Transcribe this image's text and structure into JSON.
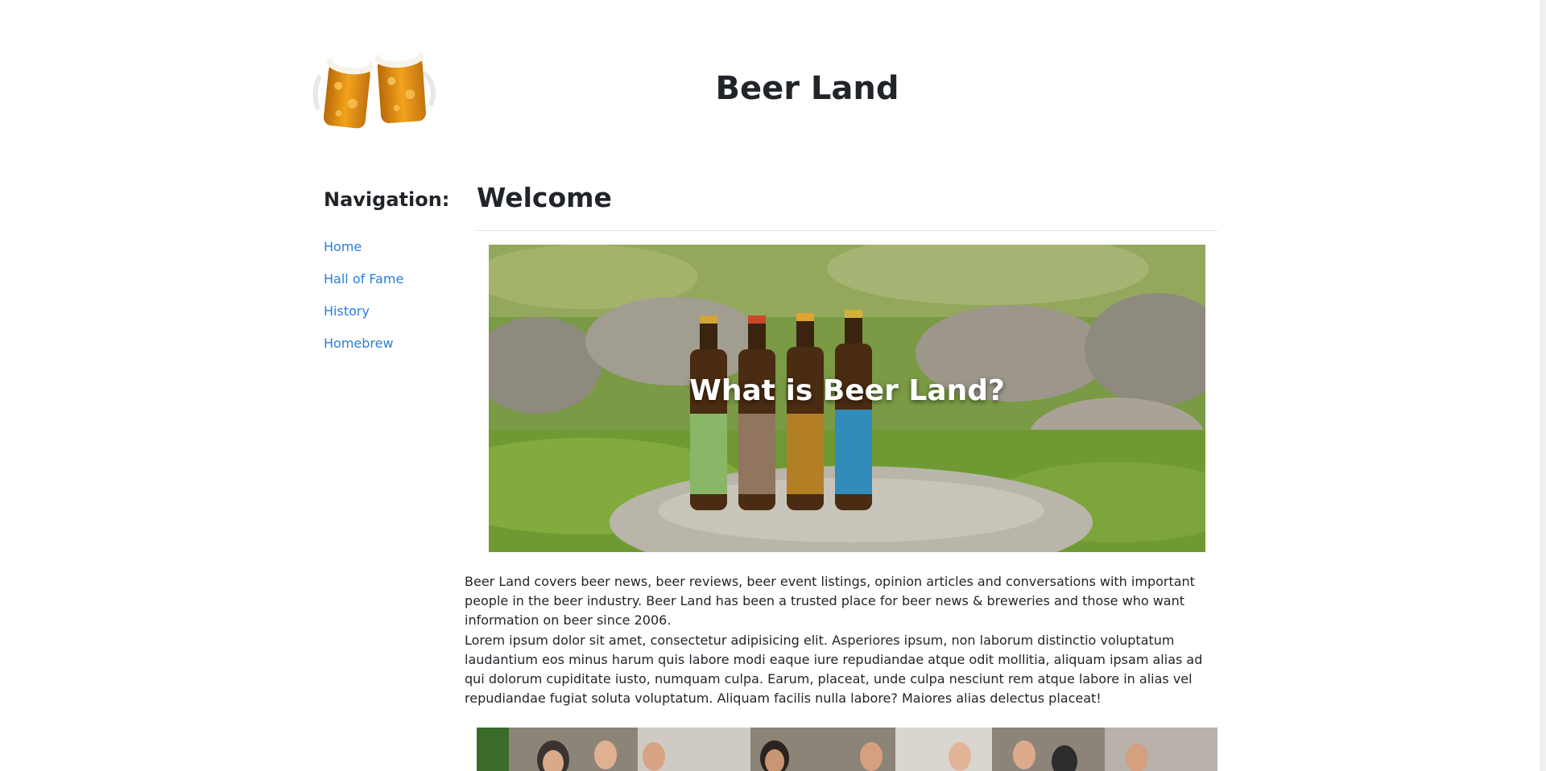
{
  "header": {
    "title": "Beer Land"
  },
  "sidebar": {
    "heading": "Navigation:",
    "items": [
      {
        "label": "Home"
      },
      {
        "label": "Hall of Fame"
      },
      {
        "label": "History"
      },
      {
        "label": "Homebrew"
      }
    ]
  },
  "main": {
    "heading": "Welcome",
    "hero_caption": "What is Beer Land?",
    "paragraphs": [
      "Beer Land covers beer news, beer reviews, beer event listings, opinion articles and conversations with important people in the beer industry. Beer Land has been a trusted place for beer news & breweries and those who want information on beer since 2006.",
      "Lorem ipsum dolor sit amet, consectetur adipisicing elit. Asperiores ipsum, non laborum distinctio voluptatum laudantium eos minus harum quis labore modi eaque iure repudiandae atque odit mollitia, aliquam ipsam alias ad qui dolorum cupiditate iusto, numquam culpa. Earum, placeat, unde culpa nesciunt rem atque labore in alias vel repudiandae fugiat soluta voluptatum. Aliquam facilis nulla labore? Maiores alias delectus placeat!"
    ]
  },
  "icons": {
    "logo": "beer-mugs-icon"
  },
  "colors": {
    "link": "#2a7de1",
    "text": "#212529",
    "divider": "#dee2e6"
  }
}
